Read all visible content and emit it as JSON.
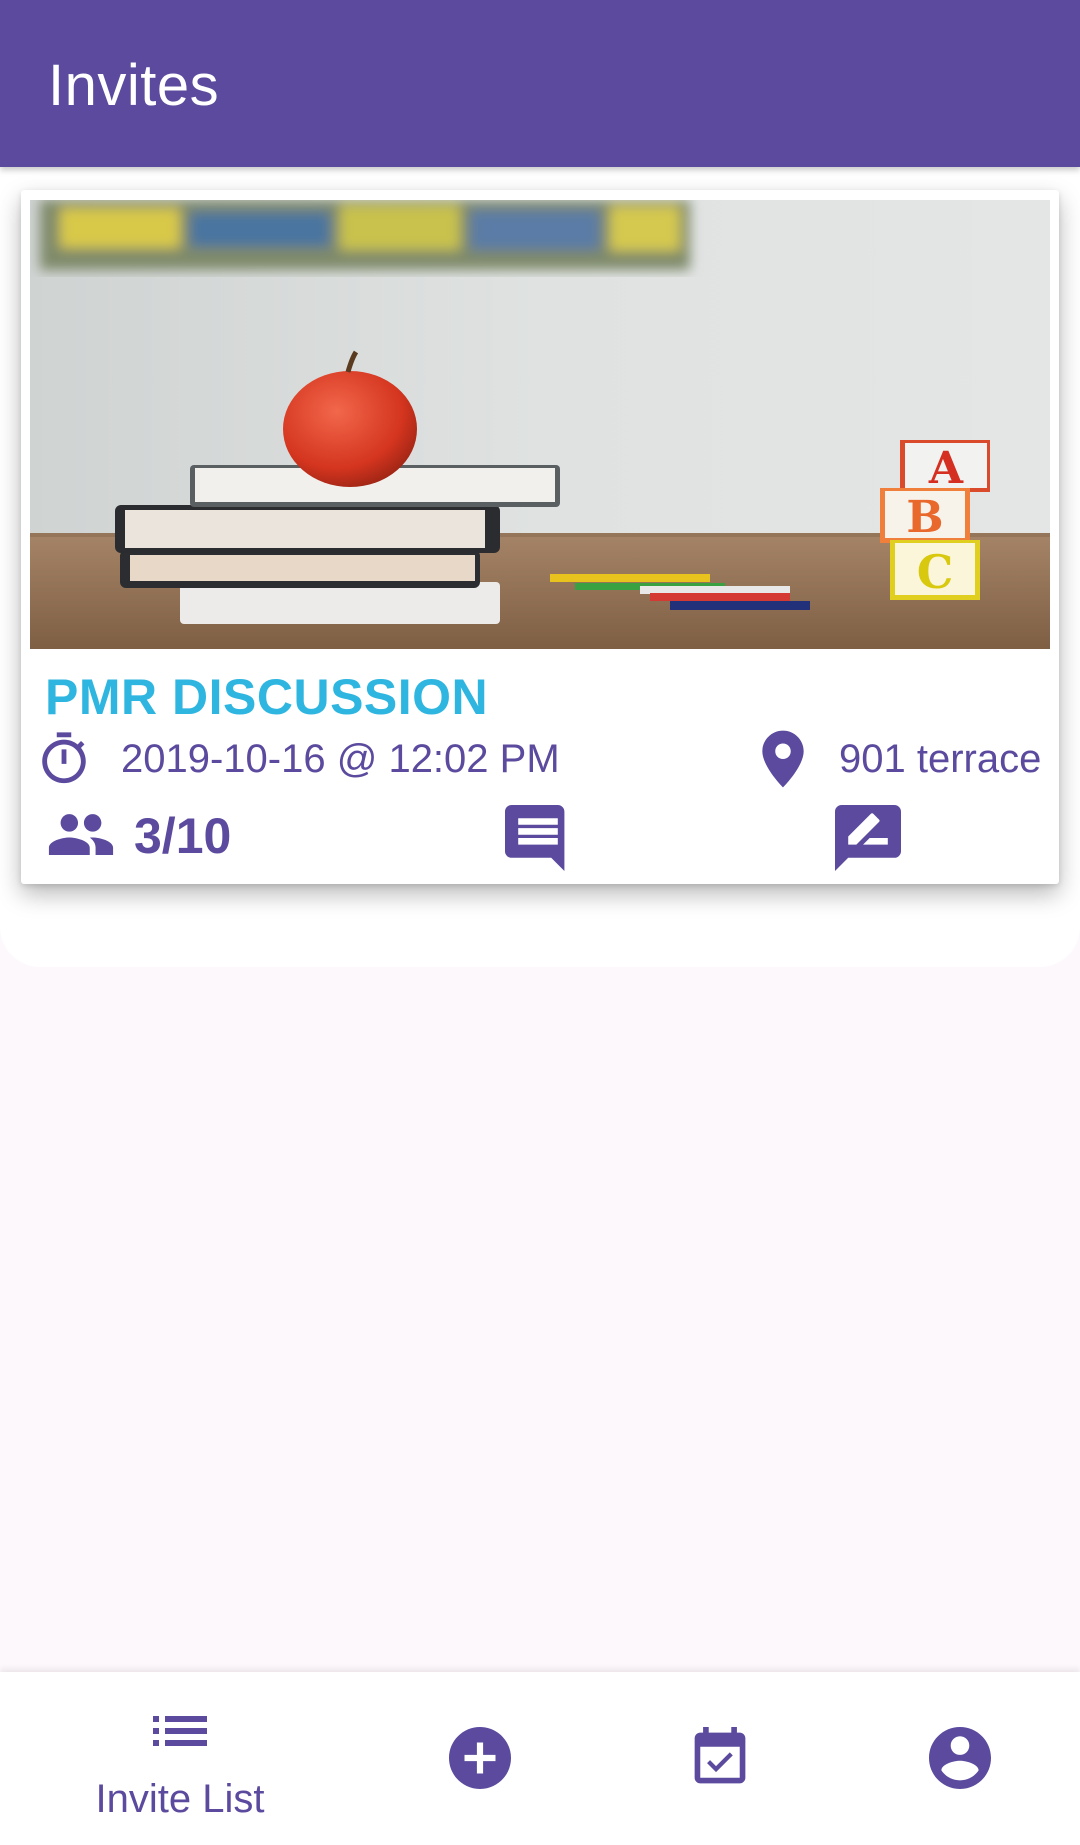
{
  "appbar": {
    "title": "Invites",
    "color": "#5b4a9e"
  },
  "invites": [
    {
      "title": "PMR DISCUSSION",
      "title_color": "#2fb6e0",
      "datetime": "2019-10-16 @ 12:02 PM",
      "location": "901 terrace",
      "attendance": "3/10",
      "icons": {
        "time": "timer-icon",
        "location": "location-pin-icon",
        "people": "people-icon",
        "chat": "chat-icon",
        "rate": "rate-review-icon"
      }
    }
  ],
  "bottom_nav": {
    "items": [
      {
        "label": "Invite List",
        "icon": "list-icon",
        "active": true
      },
      {
        "label": "",
        "icon": "add-circle-icon",
        "active": false
      },
      {
        "label": "",
        "icon": "event-available-icon",
        "active": false
      },
      {
        "label": "",
        "icon": "account-circle-icon",
        "active": false
      }
    ]
  },
  "colors": {
    "accent": "#5b4a9e",
    "title": "#2fb6e0",
    "background": "#fdf8fc"
  }
}
